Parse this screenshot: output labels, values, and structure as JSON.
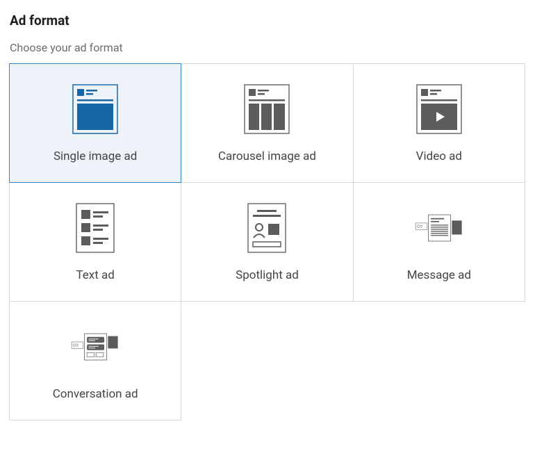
{
  "header": {
    "title": "Ad format",
    "subtitle": "Choose your ad format"
  },
  "formats": [
    {
      "id": "single-image",
      "label": "Single image ad",
      "selected": true
    },
    {
      "id": "carousel",
      "label": "Carousel image ad",
      "selected": false
    },
    {
      "id": "video",
      "label": "Video ad",
      "selected": false
    },
    {
      "id": "text",
      "label": "Text ad",
      "selected": false
    },
    {
      "id": "spotlight",
      "label": "Spotlight ad",
      "selected": false
    },
    {
      "id": "message",
      "label": "Message ad",
      "selected": false
    },
    {
      "id": "conversation",
      "label": "Conversation ad",
      "selected": false
    }
  ],
  "colors": {
    "accent": "#2a83c9",
    "selected_bg": "#edf3f8",
    "icon_gray": "#5c5c5c",
    "icon_border": "#6b6b6b"
  }
}
